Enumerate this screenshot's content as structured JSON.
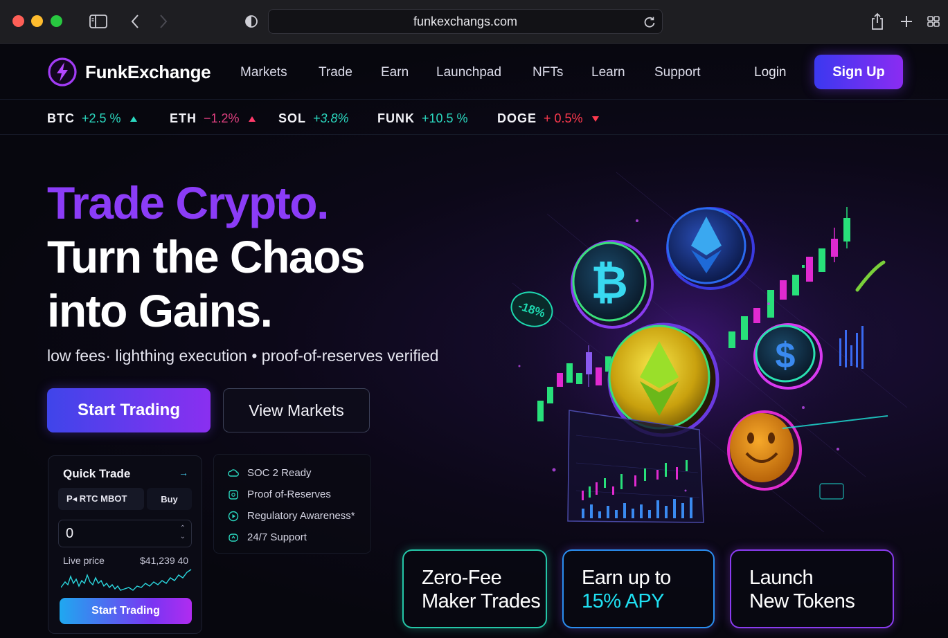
{
  "browser": {
    "url": "funkexchangs.com"
  },
  "header": {
    "brand": "FunkExchange",
    "nav": [
      "Markets",
      "Trade",
      "Earn",
      "Launchpad",
      "NFTs",
      "Learn",
      "Support"
    ],
    "login": "Login",
    "signup": "Sign Up"
  },
  "ticker": [
    {
      "symbol": "BTC",
      "change": "+2.5 %",
      "direction": "up",
      "color": "#2bd9c0"
    },
    {
      "symbol": "ETH",
      "change": "−1.2%",
      "direction": "up",
      "color": "#e04080"
    },
    {
      "symbol": "SOL",
      "change": "+3.8%",
      "direction": "none",
      "color": "#2bd9c0"
    },
    {
      "symbol": "FUNK",
      "change": "+10.5 %",
      "direction": "none",
      "color": "#2bd9c0"
    },
    {
      "symbol": "DOGE",
      "change": "+ 0.5%",
      "direction": "down",
      "color": "#ff3a4e"
    }
  ],
  "hero": {
    "line1": "Trade Crypto.",
    "line2": "Turn the Chaos",
    "line3": "into Gains.",
    "tagline": "low fees· lighthing execution • proof-of-reserves verified",
    "primary_cta": "Start Trading",
    "secondary_cta": "View Markets"
  },
  "quick_trade": {
    "title": "Quick Trade",
    "arrow": "→",
    "pair": "P◂ RTC MBOT",
    "side": "Buy",
    "amount": "0",
    "live_label": "Live price",
    "live_price": "$41,239 40",
    "cta": "Start Trading"
  },
  "trust": [
    {
      "icon": "cloud-icon",
      "label": "SOC 2 Ready"
    },
    {
      "icon": "shield-icon",
      "label": "Proof  of-Reserves"
    },
    {
      "icon": "play-circle-icon",
      "label": "Regulatory Awareness*"
    },
    {
      "icon": "chat-icon",
      "label": "24/7 Support"
    }
  ],
  "features": {
    "card1": {
      "line1": "Zero-Fee",
      "line2": "Maker Trades"
    },
    "card2": {
      "line1": "Earn up to",
      "line2": "15% APY"
    },
    "card3": {
      "line1": "Launch",
      "line2": "New Tokens"
    }
  },
  "illustration": {
    "badge": "-18%",
    "coins": [
      "bitcoin-coin",
      "ethereum-coin-blue",
      "ethereum-coin-gold",
      "dollar-coin",
      "smiley-coin"
    ]
  }
}
